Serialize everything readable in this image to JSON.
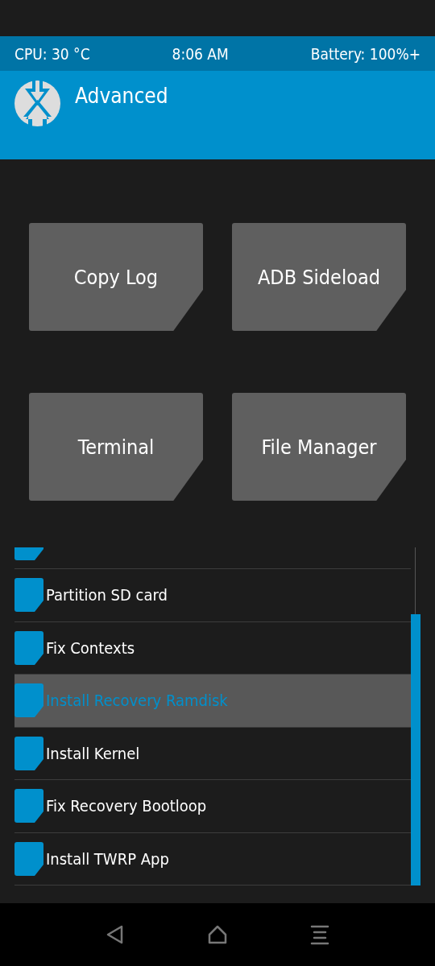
{
  "status_bar": {
    "cpu": "CPU: 30 °C",
    "time": "8:06 AM",
    "battery": "Battery: 100%+"
  },
  "header": {
    "title": "Advanced"
  },
  "buttons": [
    "Copy Log",
    "ADB Sideload",
    "Terminal",
    "File Manager"
  ],
  "list": [
    {
      "kind": "cut"
    },
    {
      "kind": "item",
      "label": "Partition SD card",
      "selected": false
    },
    {
      "kind": "item",
      "label": "Fix Contexts",
      "selected": false
    },
    {
      "kind": "item",
      "label": "Install Recovery Ramdisk",
      "selected": true
    },
    {
      "kind": "item",
      "label": "Install Kernel",
      "selected": false
    },
    {
      "kind": "item",
      "label": "Fix Recovery Bootloop",
      "selected": false
    },
    {
      "kind": "item",
      "label": "Install TWRP App",
      "selected": false
    }
  ],
  "nav_bar": {
    "buttons": [
      {
        "kind": "back"
      },
      {
        "kind": "home"
      },
      {
        "kind": "menu"
      }
    ]
  }
}
